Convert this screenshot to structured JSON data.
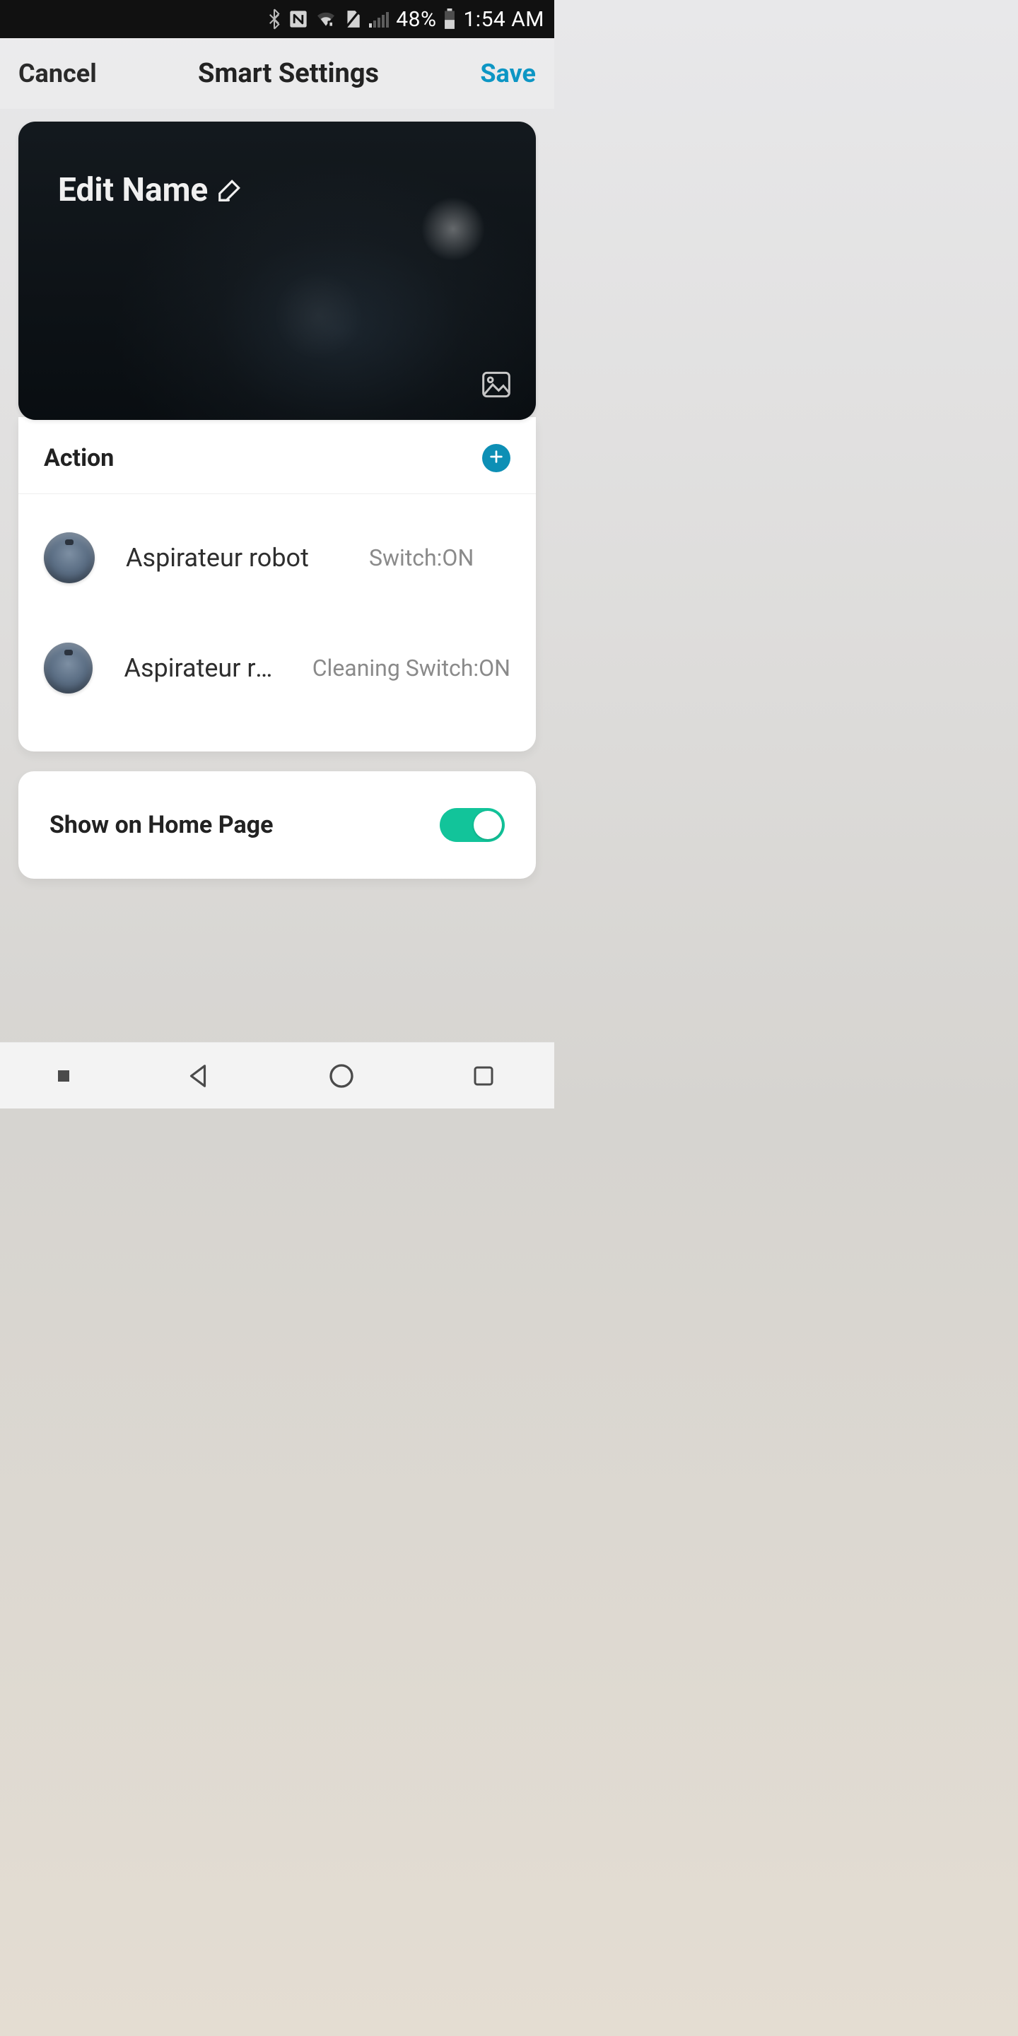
{
  "status": {
    "battery_pct": "48%",
    "time": "1:54 AM"
  },
  "header": {
    "cancel": "Cancel",
    "title": "Smart Settings",
    "save": "Save"
  },
  "hero": {
    "name": "Edit Name"
  },
  "action": {
    "heading": "Action",
    "items": [
      {
        "name": "Aspirateur robot",
        "state": "Switch:ON"
      },
      {
        "name": "Aspirateur ro…",
        "state": "Cleaning Switch:ON"
      }
    ]
  },
  "home_toggle": {
    "label": "Show on Home Page",
    "on": true
  },
  "colors": {
    "accent": "#0d96c4",
    "toggle_on": "#12c49a",
    "add_btn": "#0d8fb5"
  }
}
